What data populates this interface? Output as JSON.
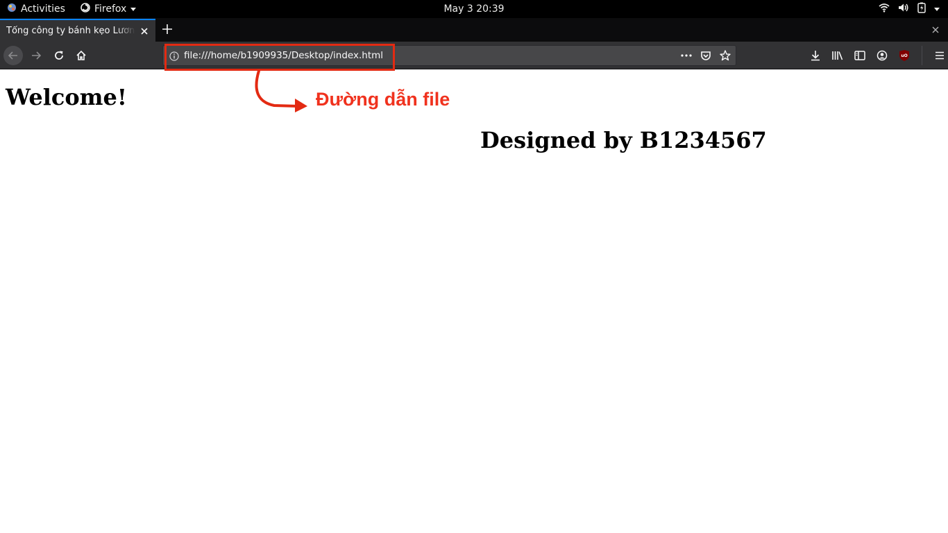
{
  "topbar": {
    "activities_label": "Activities",
    "app_menu_label": "Firefox",
    "clock": "May 3  20:39",
    "icons": [
      "wifi-icon",
      "volume-icon",
      "battery-icon",
      "system-menu-arrow"
    ]
  },
  "tab": {
    "title": "Tổng công ty bánh kẹo Lương"
  },
  "urlbar": {
    "url": "file:///home/b1909935/Desktop/index.html"
  },
  "annotation": {
    "label": "Đường dẫn file",
    "color": "#e32a12"
  },
  "page": {
    "heading": "Welcome!",
    "subheading": "Designed by B1234567"
  },
  "colors": {
    "accent": "#0a84ff",
    "toolbar": "#323234",
    "tabstrip": "#0c0c0d",
    "ublock": "#800000"
  }
}
